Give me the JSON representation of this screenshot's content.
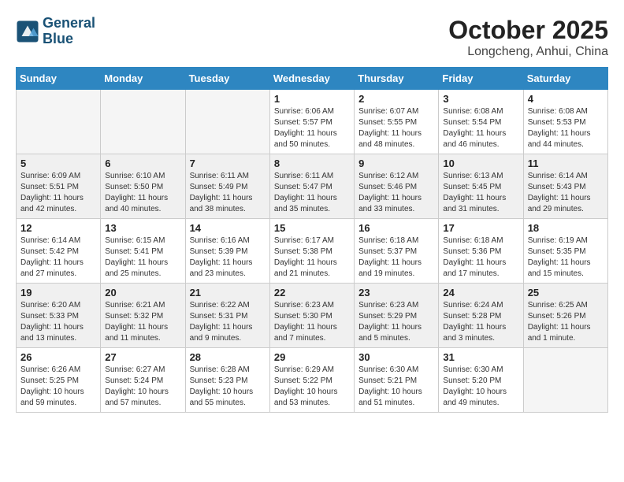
{
  "header": {
    "logo_line1": "General",
    "logo_line2": "Blue",
    "month": "October 2025",
    "location": "Longcheng, Anhui, China"
  },
  "weekdays": [
    "Sunday",
    "Monday",
    "Tuesday",
    "Wednesday",
    "Thursday",
    "Friday",
    "Saturday"
  ],
  "weeks": [
    [
      {
        "day": "",
        "sunrise": "",
        "sunset": "",
        "daylight": "",
        "empty": true
      },
      {
        "day": "",
        "sunrise": "",
        "sunset": "",
        "daylight": "",
        "empty": true
      },
      {
        "day": "",
        "sunrise": "",
        "sunset": "",
        "daylight": "",
        "empty": true
      },
      {
        "day": "1",
        "sunrise": "Sunrise: 6:06 AM",
        "sunset": "Sunset: 5:57 PM",
        "daylight": "Daylight: 11 hours and 50 minutes.",
        "empty": false
      },
      {
        "day": "2",
        "sunrise": "Sunrise: 6:07 AM",
        "sunset": "Sunset: 5:55 PM",
        "daylight": "Daylight: 11 hours and 48 minutes.",
        "empty": false
      },
      {
        "day": "3",
        "sunrise": "Sunrise: 6:08 AM",
        "sunset": "Sunset: 5:54 PM",
        "daylight": "Daylight: 11 hours and 46 minutes.",
        "empty": false
      },
      {
        "day": "4",
        "sunrise": "Sunrise: 6:08 AM",
        "sunset": "Sunset: 5:53 PM",
        "daylight": "Daylight: 11 hours and 44 minutes.",
        "empty": false
      }
    ],
    [
      {
        "day": "5",
        "sunrise": "Sunrise: 6:09 AM",
        "sunset": "Sunset: 5:51 PM",
        "daylight": "Daylight: 11 hours and 42 minutes.",
        "empty": false
      },
      {
        "day": "6",
        "sunrise": "Sunrise: 6:10 AM",
        "sunset": "Sunset: 5:50 PM",
        "daylight": "Daylight: 11 hours and 40 minutes.",
        "empty": false
      },
      {
        "day": "7",
        "sunrise": "Sunrise: 6:11 AM",
        "sunset": "Sunset: 5:49 PM",
        "daylight": "Daylight: 11 hours and 38 minutes.",
        "empty": false
      },
      {
        "day": "8",
        "sunrise": "Sunrise: 6:11 AM",
        "sunset": "Sunset: 5:47 PM",
        "daylight": "Daylight: 11 hours and 35 minutes.",
        "empty": false
      },
      {
        "day": "9",
        "sunrise": "Sunrise: 6:12 AM",
        "sunset": "Sunset: 5:46 PM",
        "daylight": "Daylight: 11 hours and 33 minutes.",
        "empty": false
      },
      {
        "day": "10",
        "sunrise": "Sunrise: 6:13 AM",
        "sunset": "Sunset: 5:45 PM",
        "daylight": "Daylight: 11 hours and 31 minutes.",
        "empty": false
      },
      {
        "day": "11",
        "sunrise": "Sunrise: 6:14 AM",
        "sunset": "Sunset: 5:43 PM",
        "daylight": "Daylight: 11 hours and 29 minutes.",
        "empty": false
      }
    ],
    [
      {
        "day": "12",
        "sunrise": "Sunrise: 6:14 AM",
        "sunset": "Sunset: 5:42 PM",
        "daylight": "Daylight: 11 hours and 27 minutes.",
        "empty": false
      },
      {
        "day": "13",
        "sunrise": "Sunrise: 6:15 AM",
        "sunset": "Sunset: 5:41 PM",
        "daylight": "Daylight: 11 hours and 25 minutes.",
        "empty": false
      },
      {
        "day": "14",
        "sunrise": "Sunrise: 6:16 AM",
        "sunset": "Sunset: 5:39 PM",
        "daylight": "Daylight: 11 hours and 23 minutes.",
        "empty": false
      },
      {
        "day": "15",
        "sunrise": "Sunrise: 6:17 AM",
        "sunset": "Sunset: 5:38 PM",
        "daylight": "Daylight: 11 hours and 21 minutes.",
        "empty": false
      },
      {
        "day": "16",
        "sunrise": "Sunrise: 6:18 AM",
        "sunset": "Sunset: 5:37 PM",
        "daylight": "Daylight: 11 hours and 19 minutes.",
        "empty": false
      },
      {
        "day": "17",
        "sunrise": "Sunrise: 6:18 AM",
        "sunset": "Sunset: 5:36 PM",
        "daylight": "Daylight: 11 hours and 17 minutes.",
        "empty": false
      },
      {
        "day": "18",
        "sunrise": "Sunrise: 6:19 AM",
        "sunset": "Sunset: 5:35 PM",
        "daylight": "Daylight: 11 hours and 15 minutes.",
        "empty": false
      }
    ],
    [
      {
        "day": "19",
        "sunrise": "Sunrise: 6:20 AM",
        "sunset": "Sunset: 5:33 PM",
        "daylight": "Daylight: 11 hours and 13 minutes.",
        "empty": false
      },
      {
        "day": "20",
        "sunrise": "Sunrise: 6:21 AM",
        "sunset": "Sunset: 5:32 PM",
        "daylight": "Daylight: 11 hours and 11 minutes.",
        "empty": false
      },
      {
        "day": "21",
        "sunrise": "Sunrise: 6:22 AM",
        "sunset": "Sunset: 5:31 PM",
        "daylight": "Daylight: 11 hours and 9 minutes.",
        "empty": false
      },
      {
        "day": "22",
        "sunrise": "Sunrise: 6:23 AM",
        "sunset": "Sunset: 5:30 PM",
        "daylight": "Daylight: 11 hours and 7 minutes.",
        "empty": false
      },
      {
        "day": "23",
        "sunrise": "Sunrise: 6:23 AM",
        "sunset": "Sunset: 5:29 PM",
        "daylight": "Daylight: 11 hours and 5 minutes.",
        "empty": false
      },
      {
        "day": "24",
        "sunrise": "Sunrise: 6:24 AM",
        "sunset": "Sunset: 5:28 PM",
        "daylight": "Daylight: 11 hours and 3 minutes.",
        "empty": false
      },
      {
        "day": "25",
        "sunrise": "Sunrise: 6:25 AM",
        "sunset": "Sunset: 5:26 PM",
        "daylight": "Daylight: 11 hours and 1 minute.",
        "empty": false
      }
    ],
    [
      {
        "day": "26",
        "sunrise": "Sunrise: 6:26 AM",
        "sunset": "Sunset: 5:25 PM",
        "daylight": "Daylight: 10 hours and 59 minutes.",
        "empty": false
      },
      {
        "day": "27",
        "sunrise": "Sunrise: 6:27 AM",
        "sunset": "Sunset: 5:24 PM",
        "daylight": "Daylight: 10 hours and 57 minutes.",
        "empty": false
      },
      {
        "day": "28",
        "sunrise": "Sunrise: 6:28 AM",
        "sunset": "Sunset: 5:23 PM",
        "daylight": "Daylight: 10 hours and 55 minutes.",
        "empty": false
      },
      {
        "day": "29",
        "sunrise": "Sunrise: 6:29 AM",
        "sunset": "Sunset: 5:22 PM",
        "daylight": "Daylight: 10 hours and 53 minutes.",
        "empty": false
      },
      {
        "day": "30",
        "sunrise": "Sunrise: 6:30 AM",
        "sunset": "Sunset: 5:21 PM",
        "daylight": "Daylight: 10 hours and 51 minutes.",
        "empty": false
      },
      {
        "day": "31",
        "sunrise": "Sunrise: 6:30 AM",
        "sunset": "Sunset: 5:20 PM",
        "daylight": "Daylight: 10 hours and 49 minutes.",
        "empty": false
      },
      {
        "day": "",
        "sunrise": "",
        "sunset": "",
        "daylight": "",
        "empty": true
      }
    ]
  ]
}
